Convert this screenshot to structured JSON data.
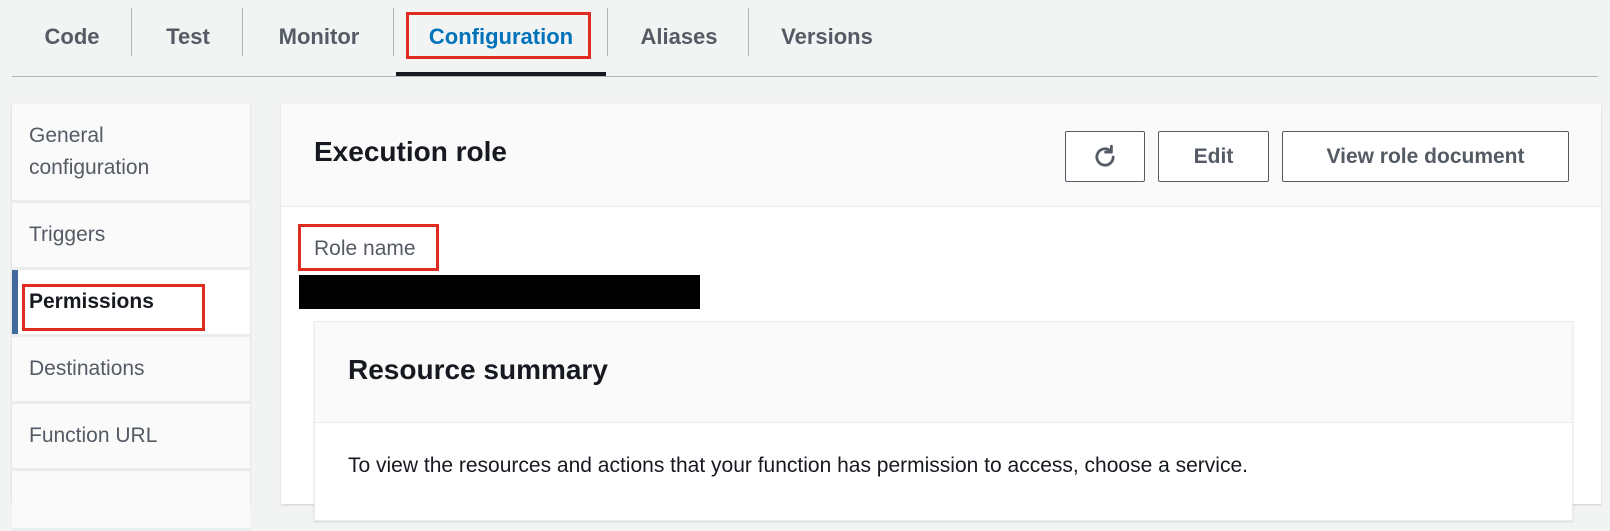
{
  "tabs": [
    {
      "label": "Code"
    },
    {
      "label": "Test"
    },
    {
      "label": "Monitor"
    },
    {
      "label": "Configuration",
      "active": true
    },
    {
      "label": "Aliases"
    },
    {
      "label": "Versions"
    }
  ],
  "sidenav": {
    "items": [
      {
        "label": "General configuration"
      },
      {
        "label": "Triggers"
      },
      {
        "label": "Permissions",
        "active": true
      },
      {
        "label": "Destinations"
      },
      {
        "label": "Function URL"
      }
    ]
  },
  "execution_role": {
    "title": "Execution role",
    "refresh_icon": "refresh-icon",
    "edit_label": "Edit",
    "view_role_document_label": "View role document",
    "role_name_label": "Role name"
  },
  "resource_summary": {
    "title": "Resource summary",
    "description": "To view the resources and actions that your function has permission to access, choose a service."
  },
  "colors": {
    "active_tab": "#0073bb",
    "highlight": "#e02b20",
    "active_indicator": "#44699c"
  }
}
